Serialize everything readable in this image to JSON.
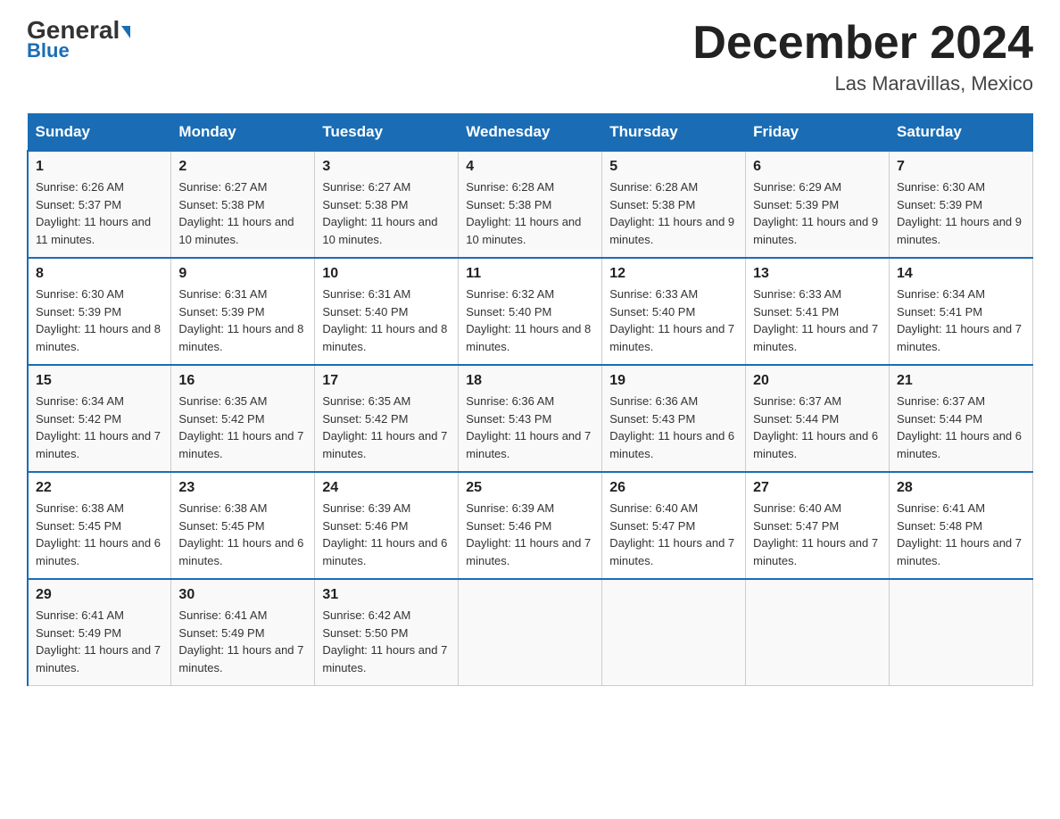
{
  "header": {
    "logo_general": "General",
    "logo_blue": "Blue",
    "month_title": "December 2024",
    "location": "Las Maravillas, Mexico"
  },
  "days_of_week": [
    "Sunday",
    "Monday",
    "Tuesday",
    "Wednesday",
    "Thursday",
    "Friday",
    "Saturday"
  ],
  "weeks": [
    [
      {
        "day": "1",
        "sunrise": "6:26 AM",
        "sunset": "5:37 PM",
        "daylight": "11 hours and 11 minutes."
      },
      {
        "day": "2",
        "sunrise": "6:27 AM",
        "sunset": "5:38 PM",
        "daylight": "11 hours and 10 minutes."
      },
      {
        "day": "3",
        "sunrise": "6:27 AM",
        "sunset": "5:38 PM",
        "daylight": "11 hours and 10 minutes."
      },
      {
        "day": "4",
        "sunrise": "6:28 AM",
        "sunset": "5:38 PM",
        "daylight": "11 hours and 10 minutes."
      },
      {
        "day": "5",
        "sunrise": "6:28 AM",
        "sunset": "5:38 PM",
        "daylight": "11 hours and 9 minutes."
      },
      {
        "day": "6",
        "sunrise": "6:29 AM",
        "sunset": "5:39 PM",
        "daylight": "11 hours and 9 minutes."
      },
      {
        "day": "7",
        "sunrise": "6:30 AM",
        "sunset": "5:39 PM",
        "daylight": "11 hours and 9 minutes."
      }
    ],
    [
      {
        "day": "8",
        "sunrise": "6:30 AM",
        "sunset": "5:39 PM",
        "daylight": "11 hours and 8 minutes."
      },
      {
        "day": "9",
        "sunrise": "6:31 AM",
        "sunset": "5:39 PM",
        "daylight": "11 hours and 8 minutes."
      },
      {
        "day": "10",
        "sunrise": "6:31 AM",
        "sunset": "5:40 PM",
        "daylight": "11 hours and 8 minutes."
      },
      {
        "day": "11",
        "sunrise": "6:32 AM",
        "sunset": "5:40 PM",
        "daylight": "11 hours and 8 minutes."
      },
      {
        "day": "12",
        "sunrise": "6:33 AM",
        "sunset": "5:40 PM",
        "daylight": "11 hours and 7 minutes."
      },
      {
        "day": "13",
        "sunrise": "6:33 AM",
        "sunset": "5:41 PM",
        "daylight": "11 hours and 7 minutes."
      },
      {
        "day": "14",
        "sunrise": "6:34 AM",
        "sunset": "5:41 PM",
        "daylight": "11 hours and 7 minutes."
      }
    ],
    [
      {
        "day": "15",
        "sunrise": "6:34 AM",
        "sunset": "5:42 PM",
        "daylight": "11 hours and 7 minutes."
      },
      {
        "day": "16",
        "sunrise": "6:35 AM",
        "sunset": "5:42 PM",
        "daylight": "11 hours and 7 minutes."
      },
      {
        "day": "17",
        "sunrise": "6:35 AM",
        "sunset": "5:42 PM",
        "daylight": "11 hours and 7 minutes."
      },
      {
        "day": "18",
        "sunrise": "6:36 AM",
        "sunset": "5:43 PM",
        "daylight": "11 hours and 7 minutes."
      },
      {
        "day": "19",
        "sunrise": "6:36 AM",
        "sunset": "5:43 PM",
        "daylight": "11 hours and 6 minutes."
      },
      {
        "day": "20",
        "sunrise": "6:37 AM",
        "sunset": "5:44 PM",
        "daylight": "11 hours and 6 minutes."
      },
      {
        "day": "21",
        "sunrise": "6:37 AM",
        "sunset": "5:44 PM",
        "daylight": "11 hours and 6 minutes."
      }
    ],
    [
      {
        "day": "22",
        "sunrise": "6:38 AM",
        "sunset": "5:45 PM",
        "daylight": "11 hours and 6 minutes."
      },
      {
        "day": "23",
        "sunrise": "6:38 AM",
        "sunset": "5:45 PM",
        "daylight": "11 hours and 6 minutes."
      },
      {
        "day": "24",
        "sunrise": "6:39 AM",
        "sunset": "5:46 PM",
        "daylight": "11 hours and 6 minutes."
      },
      {
        "day": "25",
        "sunrise": "6:39 AM",
        "sunset": "5:46 PM",
        "daylight": "11 hours and 7 minutes."
      },
      {
        "day": "26",
        "sunrise": "6:40 AM",
        "sunset": "5:47 PM",
        "daylight": "11 hours and 7 minutes."
      },
      {
        "day": "27",
        "sunrise": "6:40 AM",
        "sunset": "5:47 PM",
        "daylight": "11 hours and 7 minutes."
      },
      {
        "day": "28",
        "sunrise": "6:41 AM",
        "sunset": "5:48 PM",
        "daylight": "11 hours and 7 minutes."
      }
    ],
    [
      {
        "day": "29",
        "sunrise": "6:41 AM",
        "sunset": "5:49 PM",
        "daylight": "11 hours and 7 minutes."
      },
      {
        "day": "30",
        "sunrise": "6:41 AM",
        "sunset": "5:49 PM",
        "daylight": "11 hours and 7 minutes."
      },
      {
        "day": "31",
        "sunrise": "6:42 AM",
        "sunset": "5:50 PM",
        "daylight": "11 hours and 7 minutes."
      },
      {
        "day": "",
        "sunrise": "",
        "sunset": "",
        "daylight": ""
      },
      {
        "day": "",
        "sunrise": "",
        "sunset": "",
        "daylight": ""
      },
      {
        "day": "",
        "sunrise": "",
        "sunset": "",
        "daylight": ""
      },
      {
        "day": "",
        "sunrise": "",
        "sunset": "",
        "daylight": ""
      }
    ]
  ]
}
